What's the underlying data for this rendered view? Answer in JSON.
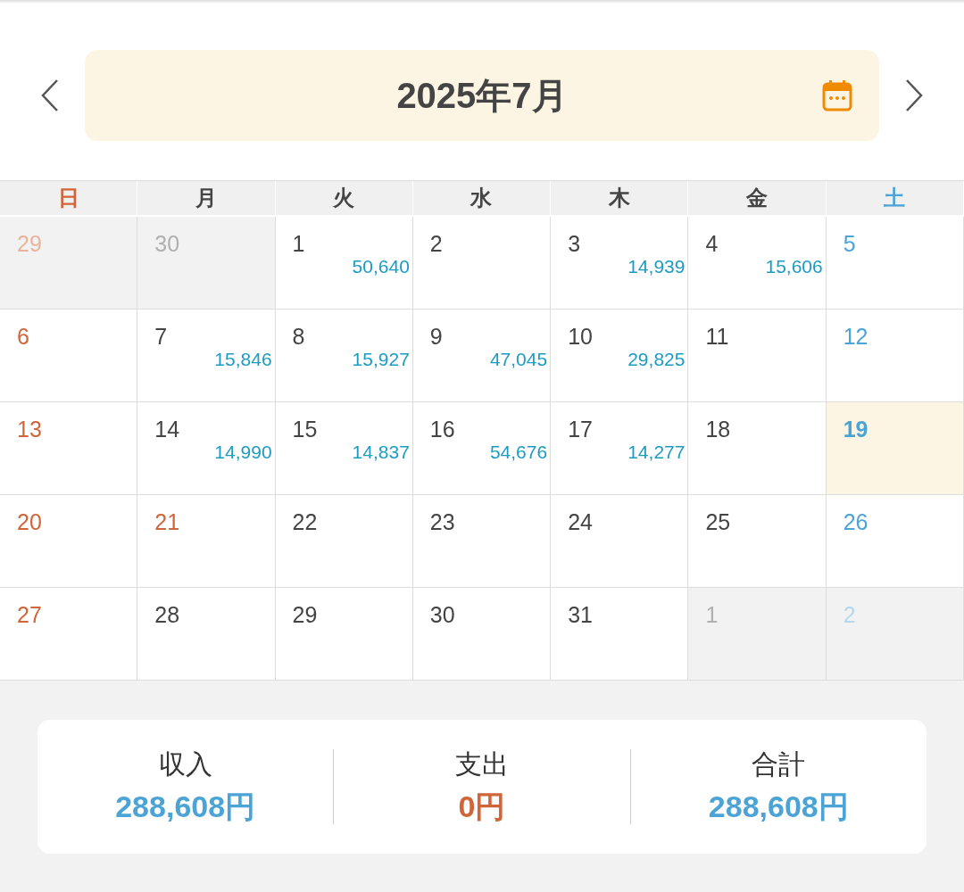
{
  "header": {
    "title": "2025年7月"
  },
  "weekdays": [
    {
      "label": "日",
      "kind": "sunday"
    },
    {
      "label": "月",
      "kind": "weekday"
    },
    {
      "label": "火",
      "kind": "weekday"
    },
    {
      "label": "水",
      "kind": "weekday"
    },
    {
      "label": "木",
      "kind": "weekday"
    },
    {
      "label": "金",
      "kind": "weekday"
    },
    {
      "label": "土",
      "kind": "saturday"
    }
  ],
  "days": [
    {
      "day": "29",
      "kind": "sunday",
      "outside": true,
      "selected": false
    },
    {
      "day": "30",
      "kind": "weekday",
      "outside": true,
      "selected": false
    },
    {
      "day": "1",
      "kind": "weekday",
      "outside": false,
      "selected": false,
      "amount": "50,640"
    },
    {
      "day": "2",
      "kind": "weekday",
      "outside": false,
      "selected": false
    },
    {
      "day": "3",
      "kind": "weekday",
      "outside": false,
      "selected": false,
      "amount": "14,939"
    },
    {
      "day": "4",
      "kind": "weekday",
      "outside": false,
      "selected": false,
      "amount": "15,606"
    },
    {
      "day": "5",
      "kind": "saturday",
      "outside": false,
      "selected": false
    },
    {
      "day": "6",
      "kind": "sunday",
      "outside": false,
      "selected": false
    },
    {
      "day": "7",
      "kind": "weekday",
      "outside": false,
      "selected": false,
      "amount": "15,846"
    },
    {
      "day": "8",
      "kind": "weekday",
      "outside": false,
      "selected": false,
      "amount": "15,927"
    },
    {
      "day": "9",
      "kind": "weekday",
      "outside": false,
      "selected": false,
      "amount": "47,045"
    },
    {
      "day": "10",
      "kind": "weekday",
      "outside": false,
      "selected": false,
      "amount": "29,825"
    },
    {
      "day": "11",
      "kind": "weekday",
      "outside": false,
      "selected": false
    },
    {
      "day": "12",
      "kind": "saturday",
      "outside": false,
      "selected": false
    },
    {
      "day": "13",
      "kind": "sunday",
      "outside": false,
      "selected": false
    },
    {
      "day": "14",
      "kind": "weekday",
      "outside": false,
      "selected": false,
      "amount": "14,990"
    },
    {
      "day": "15",
      "kind": "weekday",
      "outside": false,
      "selected": false,
      "amount": "14,837"
    },
    {
      "day": "16",
      "kind": "weekday",
      "outside": false,
      "selected": false,
      "amount": "54,676"
    },
    {
      "day": "17",
      "kind": "weekday",
      "outside": false,
      "selected": false,
      "amount": "14,277"
    },
    {
      "day": "18",
      "kind": "weekday",
      "outside": false,
      "selected": false
    },
    {
      "day": "19",
      "kind": "saturday",
      "outside": false,
      "selected": true
    },
    {
      "day": "20",
      "kind": "sunday",
      "outside": false,
      "selected": false
    },
    {
      "day": "21",
      "kind": "sunday",
      "outside": false,
      "selected": false
    },
    {
      "day": "22",
      "kind": "weekday",
      "outside": false,
      "selected": false
    },
    {
      "day": "23",
      "kind": "weekday",
      "outside": false,
      "selected": false
    },
    {
      "day": "24",
      "kind": "weekday",
      "outside": false,
      "selected": false
    },
    {
      "day": "25",
      "kind": "weekday",
      "outside": false,
      "selected": false
    },
    {
      "day": "26",
      "kind": "saturday",
      "outside": false,
      "selected": false
    },
    {
      "day": "27",
      "kind": "sunday",
      "outside": false,
      "selected": false
    },
    {
      "day": "28",
      "kind": "weekday",
      "outside": false,
      "selected": false
    },
    {
      "day": "29",
      "kind": "weekday",
      "outside": false,
      "selected": false
    },
    {
      "day": "30",
      "kind": "weekday",
      "outside": false,
      "selected": false
    },
    {
      "day": "31",
      "kind": "weekday",
      "outside": false,
      "selected": false
    },
    {
      "day": "1",
      "kind": "weekday",
      "outside": true,
      "selected": false
    },
    {
      "day": "2",
      "kind": "saturday",
      "outside": true,
      "selected": false
    }
  ],
  "summary": [
    {
      "label": "収入",
      "value": "288,608円",
      "kind": "income"
    },
    {
      "label": "支出",
      "value": "0円",
      "kind": "expense"
    },
    {
      "label": "合計",
      "value": "288,608円",
      "kind": "income"
    }
  ]
}
